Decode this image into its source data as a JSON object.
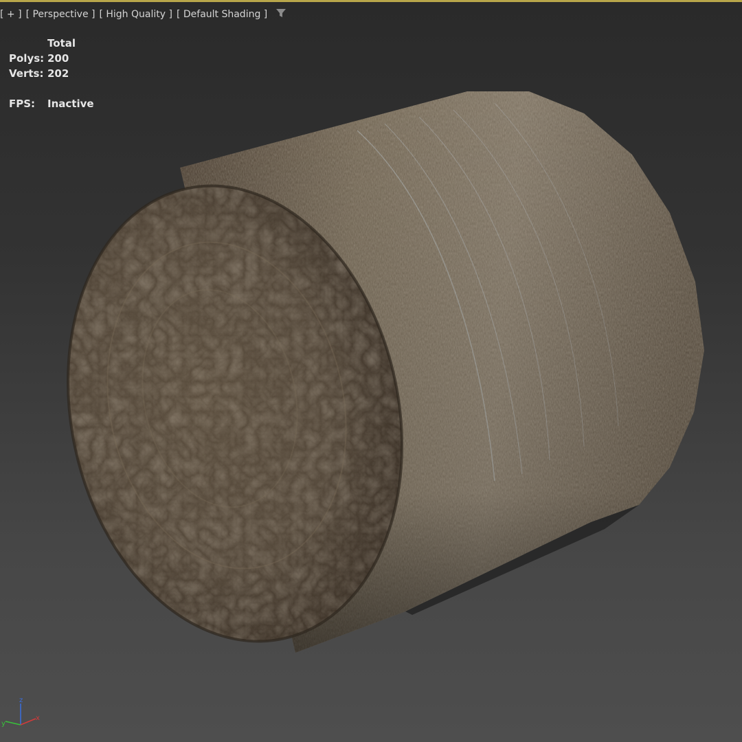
{
  "viewport": {
    "labels": [
      "[ + ]",
      "[ Perspective ]",
      "[ High Quality ]",
      "[ Default Shading ]"
    ],
    "filter_icon": "funnel-icon"
  },
  "stats": {
    "header": "Total",
    "polys_label": "Polys:",
    "polys_value": "200",
    "verts_label": "Verts:",
    "verts_value": "202",
    "fps_label": "FPS:",
    "fps_value": "Inactive"
  },
  "gizmo": {
    "x_label": "x",
    "y_label": "y",
    "z_label": "z",
    "x_color": "#d23a3a",
    "y_color": "#38c23a",
    "z_color": "#3a6ee0"
  },
  "colors": {
    "active_border": "#b8a64a",
    "label_text": "#d4d4d4",
    "stats_text": "#e6e6e6"
  },
  "scene": {
    "object_icon": "hay-bale-object"
  }
}
